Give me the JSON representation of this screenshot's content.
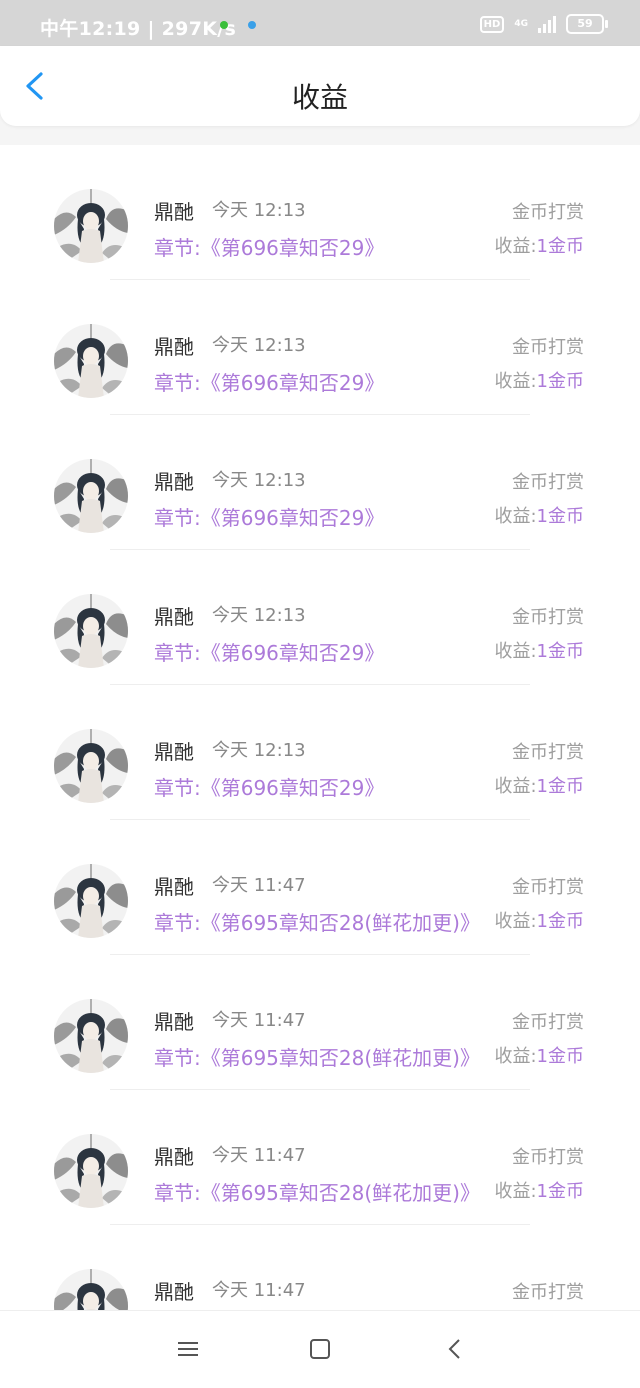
{
  "status_bar": {
    "time": "中午12:19 | 297K/s",
    "hd_badge": "HD",
    "network": "4G",
    "battery": "59"
  },
  "header": {
    "title": "收益"
  },
  "list": {
    "items": [
      {
        "name": "鼎酏",
        "time": "今天 12:13",
        "chapter": "章节:《第696章知否29》",
        "type": "金币打赏",
        "earn_label": "收益:",
        "earn_amount": "1金币"
      },
      {
        "name": "鼎酏",
        "time": "今天 12:13",
        "chapter": "章节:《第696章知否29》",
        "type": "金币打赏",
        "earn_label": "收益:",
        "earn_amount": "1金币"
      },
      {
        "name": "鼎酏",
        "time": "今天 12:13",
        "chapter": "章节:《第696章知否29》",
        "type": "金币打赏",
        "earn_label": "收益:",
        "earn_amount": "1金币"
      },
      {
        "name": "鼎酏",
        "time": "今天 12:13",
        "chapter": "章节:《第696章知否29》",
        "type": "金币打赏",
        "earn_label": "收益:",
        "earn_amount": "1金币"
      },
      {
        "name": "鼎酏",
        "time": "今天 12:13",
        "chapter": "章节:《第696章知否29》",
        "type": "金币打赏",
        "earn_label": "收益:",
        "earn_amount": "1金币"
      },
      {
        "name": "鼎酏",
        "time": "今天 11:47",
        "chapter": "章节:《第695章知否28(鲜花加更)》",
        "type": "金币打赏",
        "earn_label": "收益:",
        "earn_amount": "1金币"
      },
      {
        "name": "鼎酏",
        "time": "今天 11:47",
        "chapter": "章节:《第695章知否28(鲜花加更)》",
        "type": "金币打赏",
        "earn_label": "收益:",
        "earn_amount": "1金币"
      },
      {
        "name": "鼎酏",
        "time": "今天 11:47",
        "chapter": "章节:《第695章知否28(鲜花加更)》",
        "type": "金币打赏",
        "earn_label": "收益:",
        "earn_amount": "1金币"
      },
      {
        "name": "鼎酏",
        "time": "今天 11:47",
        "chapter": "",
        "type": "金币打赏",
        "earn_label": "",
        "earn_amount": ""
      }
    ]
  },
  "colors": {
    "accent_purple": "#ac7ad9",
    "back_blue": "#2196f3",
    "status_bar_bg": "#d6d6d6"
  },
  "icons": {
    "back": "chevron-left-icon",
    "nav_menu": "menu-icon",
    "nav_home": "square-home-icon",
    "nav_back": "chevron-left-icon"
  }
}
